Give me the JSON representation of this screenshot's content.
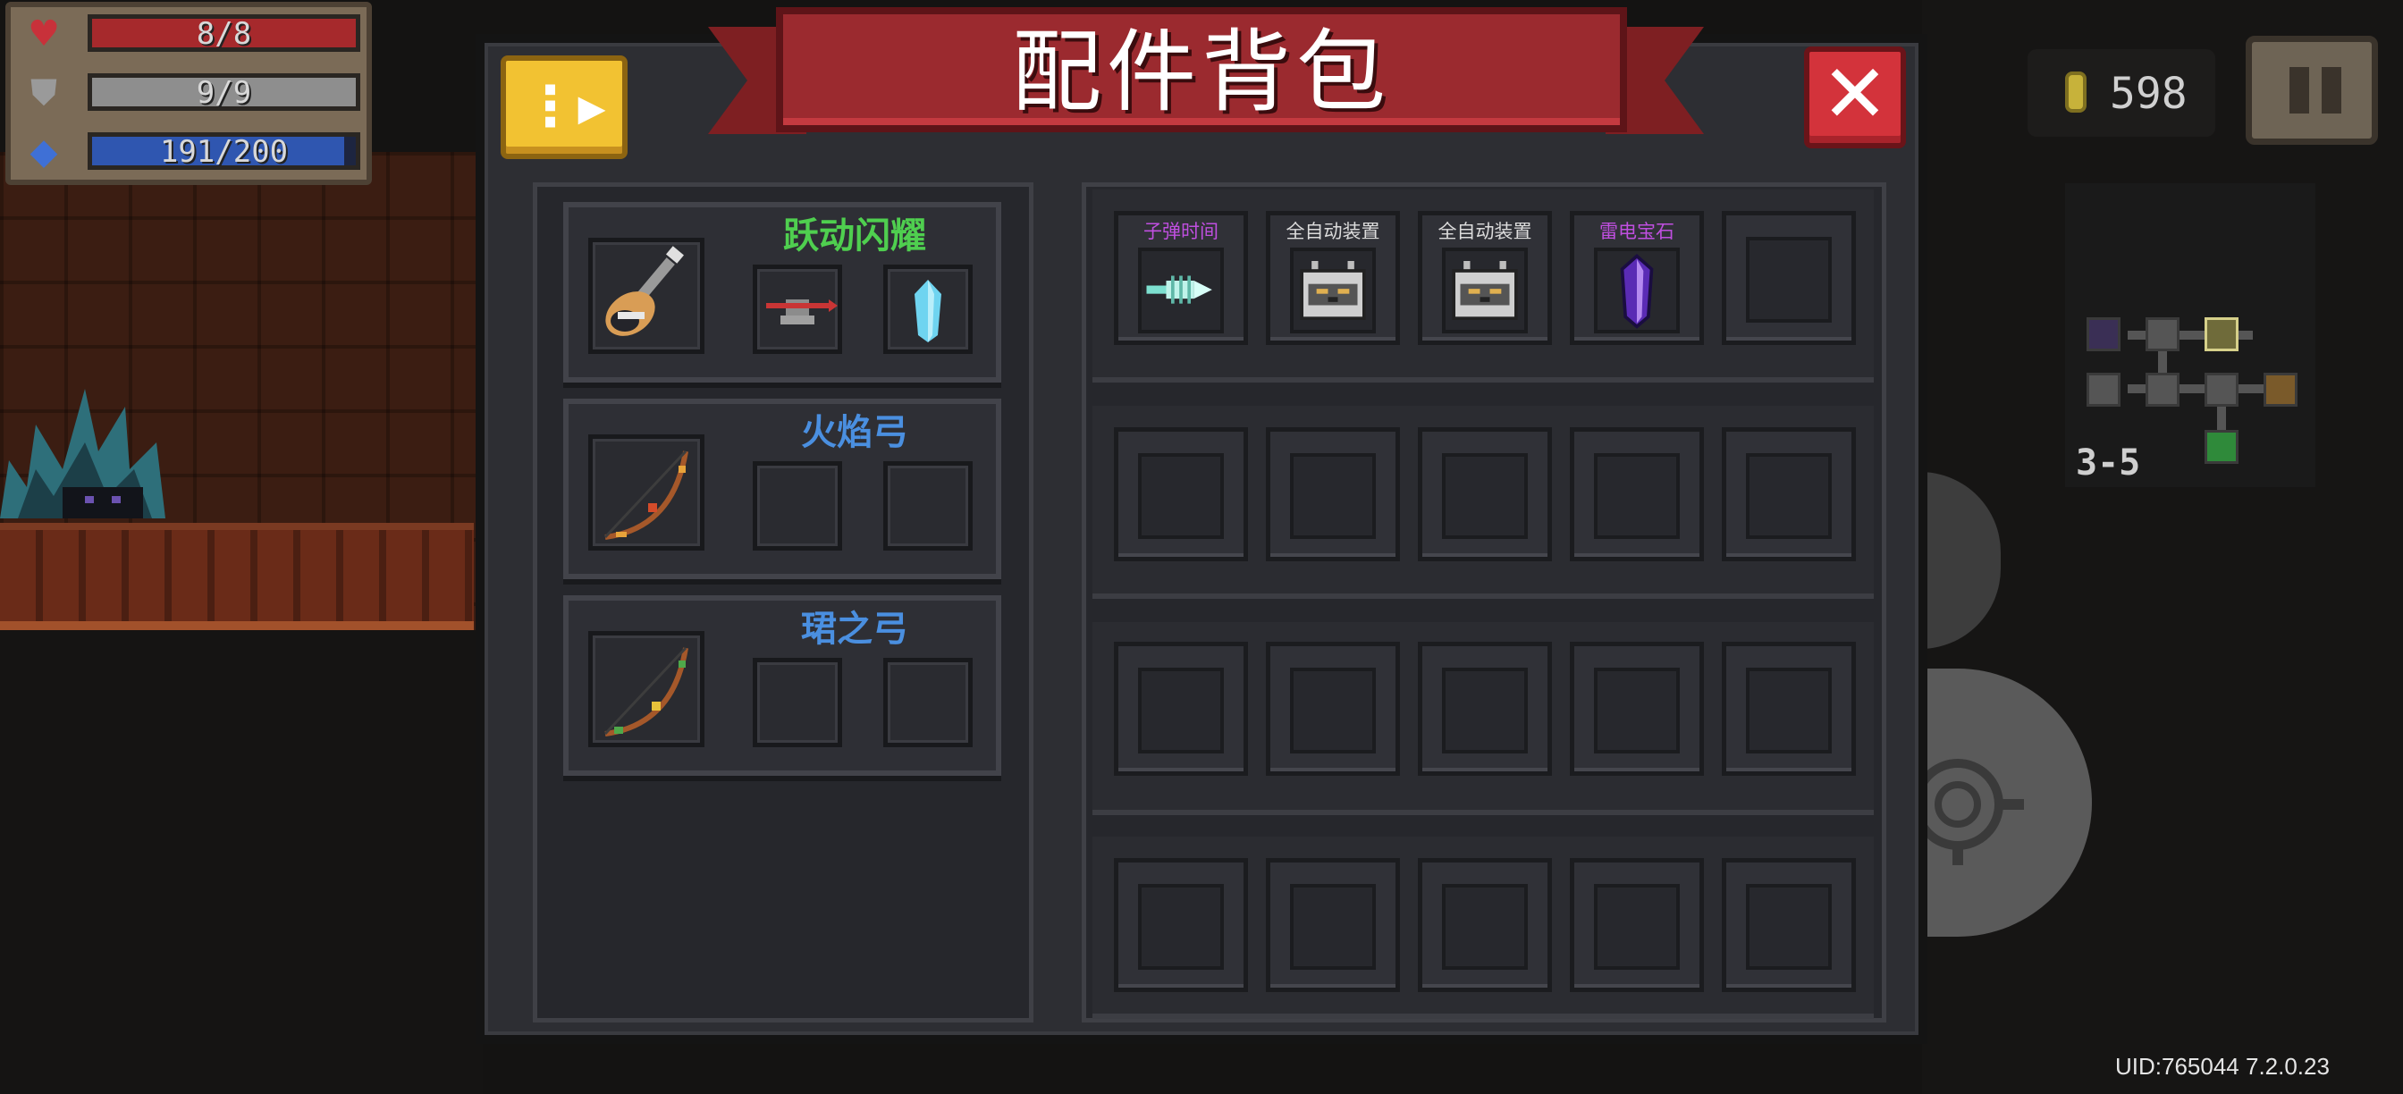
{
  "hud": {
    "health": {
      "text": "8/8",
      "fraction": 1.0,
      "color": "#a6292c"
    },
    "armor": {
      "text": "9/9",
      "fraction": 1.0,
      "color": "#8e8e8e"
    },
    "energy": {
      "text": "191/200",
      "fraction": 0.955,
      "color": "#2f56b0"
    },
    "coins": "598",
    "level": "3-5"
  },
  "dialog": {
    "title": "配件背包",
    "sort_icon": "sort-icon",
    "close_icon": "close-icon"
  },
  "weapons": [
    {
      "name": "跃动闪耀",
      "name_color": "#4fcf4f",
      "icon": "electric-guitar-icon",
      "parts": [
        "arrow-target-part-icon",
        "ice-crystal-part-icon"
      ]
    },
    {
      "name": "火焰弓",
      "name_color": "#4a8fe0",
      "icon": "flame-bow-icon",
      "parts": [
        "",
        ""
      ]
    },
    {
      "name": "珺之弓",
      "name_color": "#4a8fe0",
      "icon": "jun-bow-icon",
      "parts": [
        "",
        ""
      ]
    }
  ],
  "parts": [
    {
      "name": "子弹时间",
      "name_color": "#c04fe0",
      "icon": "bullet-time-icon"
    },
    {
      "name": "全自动装置",
      "name_color": "#dcdcdc",
      "icon": "auto-device-icon"
    },
    {
      "name": "全自动装置",
      "name_color": "#dcdcdc",
      "icon": "auto-device-icon"
    },
    {
      "name": "雷电宝石",
      "name_color": "#c04fe0",
      "icon": "thunder-gem-icon"
    }
  ],
  "empty_part_slots": 16,
  "uid": "UID:765044 7.2.0.23"
}
